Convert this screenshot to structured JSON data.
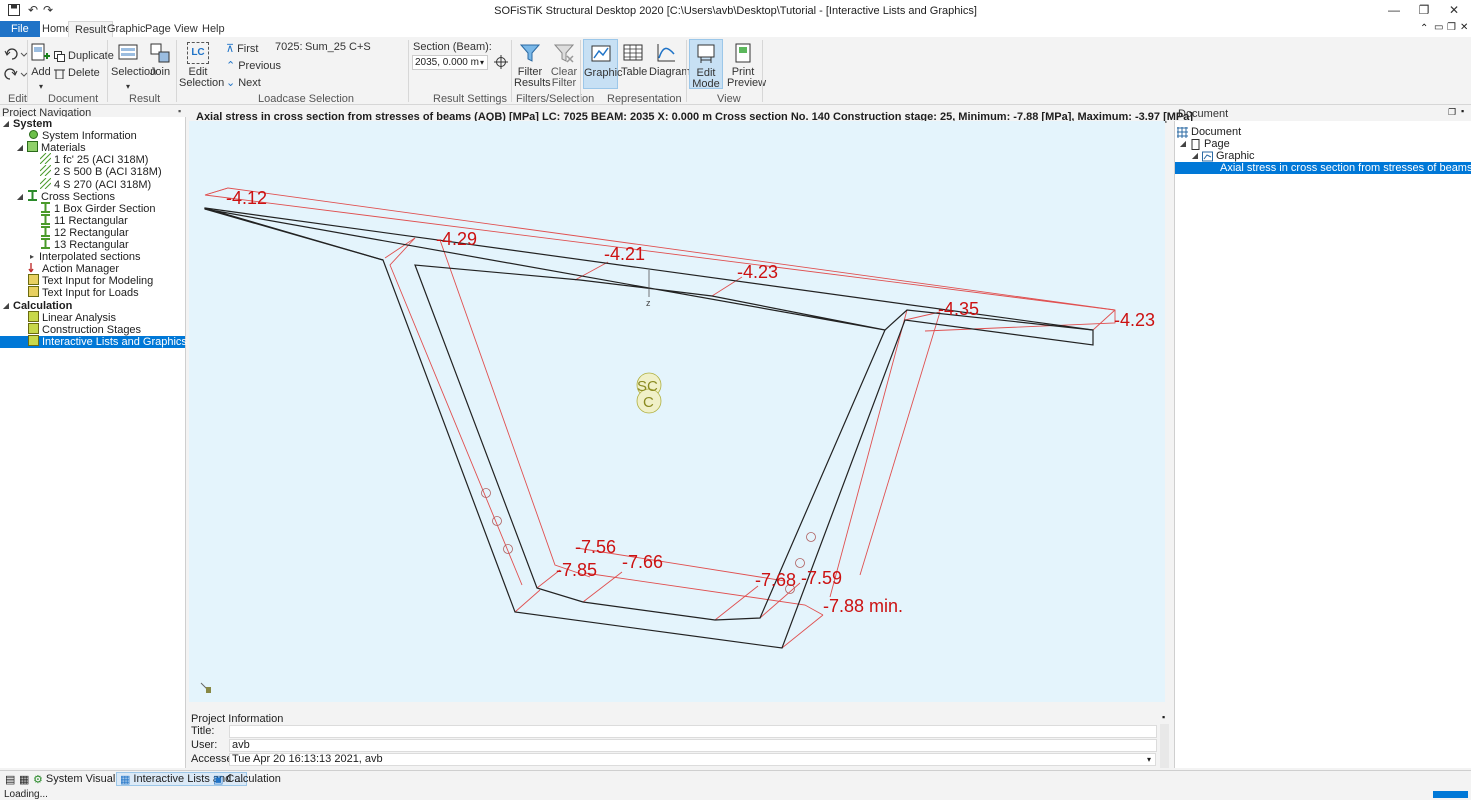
{
  "app": {
    "title": "SOFiSTiK Structural Desktop 2020  [C:\\Users\\avb\\Desktop\\Tutorial - [Interactive Lists and Graphics]"
  },
  "tabs": [
    "File",
    "Home",
    "Result",
    "Graphic",
    "Page",
    "View",
    "Help"
  ],
  "ribbon": {
    "groups": {
      "edit": "Edit",
      "document": "Document",
      "result": "Result",
      "loadcase": "Loadcase Selection",
      "result_settings": "Result Settings",
      "filters": "Filters/Selection",
      "representation": "Representation",
      "view": "View"
    },
    "add": "Add",
    "duplicate": "Duplicate",
    "delete": "Delete",
    "selection": "Selection",
    "join": "Join",
    "edit_selection_1": "Edit",
    "edit_selection_2": "Selection",
    "edit_selection_icon_text": "LC",
    "first": "First",
    "previous": "Previous",
    "next": "Next",
    "loadcase_number": "7025:",
    "loadcase_name": "Sum_25 C+S",
    "section_label": "Section (Beam):",
    "section_value": "2035, 0.000 m",
    "filter_results_1": "Filter",
    "filter_results_2": "Results",
    "clear_filter_1": "Clear",
    "clear_filter_2": "Filter",
    "graphic": "Graphic",
    "table": "Table",
    "diagram": "Diagram",
    "edit_mode_1": "Edit",
    "edit_mode_2": "Mode",
    "print_preview_1": "Print",
    "print_preview_2": "Preview"
  },
  "nav": {
    "header": "Project Navigation",
    "items": [
      {
        "label": "System",
        "bold": true
      },
      {
        "label": "System Information"
      },
      {
        "label": "Materials"
      },
      {
        "label": "1 fc' 25 (ACI 318M)"
      },
      {
        "label": "2 S 500 B (ACI 318M)"
      },
      {
        "label": "4 S 270 (ACI 318M)"
      },
      {
        "label": "Cross Sections"
      },
      {
        "label": "1 Box Girder Section"
      },
      {
        "label": "11 Rectangular"
      },
      {
        "label": "12 Rectangular"
      },
      {
        "label": "13 Rectangular"
      },
      {
        "label": "Interpolated sections"
      },
      {
        "label": "Action Manager"
      },
      {
        "label": "Text Input for Modeling"
      },
      {
        "label": "Text Input for Loads"
      },
      {
        "label": "Calculation",
        "bold": true
      },
      {
        "label": "Linear Analysis"
      },
      {
        "label": "Construction Stages"
      },
      {
        "label": "Interactive Lists and Graphics"
      }
    ]
  },
  "graphic": {
    "title": "Axial stress in cross section from stresses of beams (AQB) [MPa] LC: 7025 BEAM: 2035 X: 0.000 m Cross section No. 140 Construction stage: 25, Minimum: -7.88 [MPa], Maximum: -3.97 [MPa]",
    "labels": [
      "-4.12",
      "-4.29",
      "-4.21",
      "-4.23",
      "-4.35",
      "-4.23",
      "-7.56",
      "-7.66",
      "-7.85",
      "-7.68",
      "-7.59",
      "-7.88 min."
    ],
    "axis_label": "z",
    "sc_top": "SC",
    "sc_bottom": "C"
  },
  "document": {
    "header": "Document",
    "items": [
      "Document",
      "Page",
      "Graphic",
      "Axial stress in cross section from stresses of beams (AQB)"
    ]
  },
  "project_info": {
    "header": "Project Information",
    "title_label": "Title:",
    "title_value": "",
    "user_label": "User:",
    "user_value": "avb",
    "accessed_label": "Accessed:",
    "accessed_value": "Tue Apr 20 16:13:13 2021, avb"
  },
  "bottom_tabs": [
    "System Visualization",
    "Interactive Lists and ...",
    "Calculation"
  ],
  "status": "Loading...",
  "colors": {
    "accent": "#0078d7",
    "file_tab": "#1f73c7",
    "canvas": "#e4f4fc",
    "stress_red": "#cc1111"
  }
}
